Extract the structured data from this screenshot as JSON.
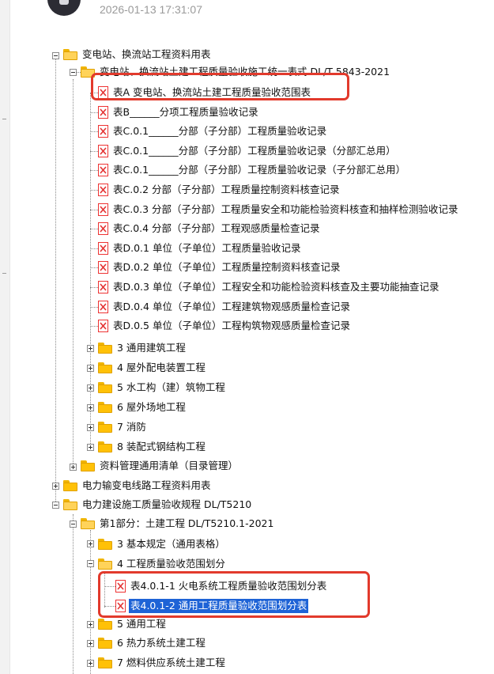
{
  "header": {
    "timestamp": "2026-01-13 17:31:07",
    "avatar_icon": "user-avatar"
  },
  "tree": {
    "root1": {
      "label": "变电站、换流站工程资料用表",
      "expanded": true
    },
    "group1": {
      "label": "变电站、换流站土建工程质量验收施工统一表式 DL/T 5843-2021",
      "expanded": true
    },
    "docs1": [
      "表A 变电站、换流站土建工程质量验收范围表",
      "表B______分项工程质量验收记录",
      "表C.0.1______分部（子分部）工程质量验收记录",
      "表C.0.1______分部（子分部）工程质量验收记录（分部汇总用）",
      "表C.0.1______分部（子分部）工程质量验收记录（子分部汇总用）",
      "表C.0.2 分部（子分部）工程质量控制资料核查记录",
      "表C.0.3 分部（子分部）工程质量安全和功能检验资料核查和抽样检测验收记录",
      "表C.0.4 分部（子分部）工程观感质量检查记录",
      "表D.0.1 单位（子单位）工程质量验收记录",
      "表D.0.2 单位（子单位）工程质量控制资料核查记录",
      "表D.0.3 单位（子单位）工程安全和功能检验资料核查及主要功能抽查记录",
      "表D.0.4 单位（子单位）工程建筑物观感质量检查记录",
      "表D.0.5 单位（子单位）工程构筑物观感质量检查记录"
    ],
    "folders1": [
      "3 通用建筑工程",
      "4 屋外配电装置工程",
      "5 水工构（建）筑物工程",
      "6 屋外场地工程",
      "7 消防",
      "8 装配式钢结构工程"
    ],
    "group2": {
      "label": "资料管理通用清单（目录管理）",
      "expanded": false
    },
    "root2": {
      "label": "电力输变电线路工程资料用表",
      "expanded": false
    },
    "root3": {
      "label": "电力建设施工质量验收规程 DL/T5210",
      "expanded": true
    },
    "part1": {
      "label": "第1部分：土建工程 DL/T5210.1-2021",
      "expanded": true
    },
    "folders2a": [
      "3 基本规定（通用表格）",
      "4 工程质量验收范围划分"
    ],
    "docs2": [
      "表4.0.1-1 火电系统工程质量验收范围划分表",
      "表4.0.1-2 通用工程质量验收范围划分表"
    ],
    "folders2b": [
      "5 通用工程",
      "6 热力系统土建工程",
      "7 燃料供应系统土建工程"
    ]
  },
  "colors": {
    "highlight_border": "#e23a2c",
    "selection_bg": "#1e63d6",
    "folder": "#ffc107",
    "doc_icon": "#e33333"
  }
}
